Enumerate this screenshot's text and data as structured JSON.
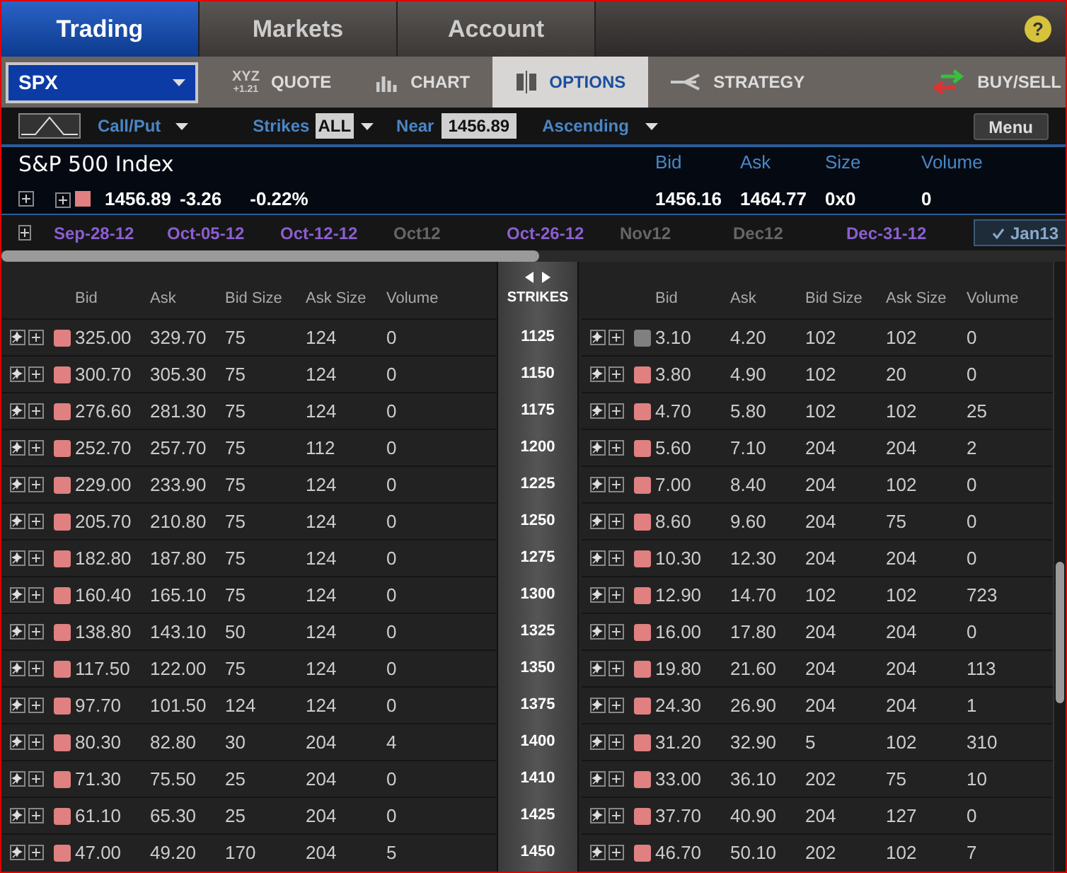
{
  "nav_tabs": [
    {
      "label": "Trading",
      "selected": true
    },
    {
      "label": "Markets",
      "selected": false
    },
    {
      "label": "Account",
      "selected": false
    }
  ],
  "help": {
    "label": "?"
  },
  "symbol": {
    "value": "SPX"
  },
  "sub_tabs": [
    {
      "label": "QUOTE",
      "kind": "quote",
      "selected": false,
      "icon_text": "XYZ",
      "icon_subtext": "+1.21"
    },
    {
      "label": "CHART",
      "kind": "chart",
      "selected": false
    },
    {
      "label": "OPTIONS",
      "kind": "options",
      "selected": true
    },
    {
      "label": "STRATEGY",
      "kind": "strategy",
      "selected": false
    }
  ],
  "buy_sell": {
    "label": "BUY/SELL"
  },
  "filters": {
    "call_put": "Call/Put",
    "strikes_label": "Strikes",
    "strikes_value": "ALL",
    "near_label": "Near",
    "near_value": "1456.89",
    "sort": "Ascending",
    "menu": "Menu"
  },
  "index": {
    "name": "S&P 500 Index",
    "last": "1456.89",
    "change": "-3.26",
    "percent": "-0.22%",
    "color": "#e08080",
    "columns": [
      "Bid",
      "Ask",
      "Size",
      "Volume"
    ],
    "values": [
      "1456.16",
      "1464.77",
      "0x0",
      "0"
    ]
  },
  "expiries": [
    {
      "label": "Sep-28-12",
      "selected": false,
      "disabled": false
    },
    {
      "label": "Oct-05-12",
      "selected": false,
      "disabled": false
    },
    {
      "label": "Oct-12-12",
      "selected": false,
      "disabled": false
    },
    {
      "label": "Oct12",
      "selected": false,
      "disabled": true
    },
    {
      "label": "Oct-26-12",
      "selected": false,
      "disabled": false
    },
    {
      "label": "Nov12",
      "selected": false,
      "disabled": true
    },
    {
      "label": "Dec12",
      "selected": false,
      "disabled": true
    },
    {
      "label": "Dec-31-12",
      "selected": false,
      "disabled": false
    },
    {
      "label": "Jan13",
      "selected": true,
      "disabled": false
    }
  ],
  "table": {
    "call_columns": [
      "Bid",
      "Ask",
      "Bid Size",
      "Ask Size",
      "Volume"
    ],
    "strikes_header": "STRIKES",
    "put_columns": [
      "Bid",
      "Ask",
      "Bid Size",
      "Ask Size",
      "Volume"
    ],
    "rows": [
      {
        "strike": "1125",
        "call": {
          "color": "#e08080",
          "values": [
            "325.00",
            "329.70",
            "75",
            "124",
            "0"
          ]
        },
        "put": {
          "color": "#808080",
          "values": [
            "3.10",
            "4.20",
            "102",
            "102",
            "0"
          ]
        }
      },
      {
        "strike": "1150",
        "call": {
          "color": "#e08080",
          "values": [
            "300.70",
            "305.30",
            "75",
            "124",
            "0"
          ]
        },
        "put": {
          "color": "#e08080",
          "values": [
            "3.80",
            "4.90",
            "102",
            "20",
            "0"
          ]
        }
      },
      {
        "strike": "1175",
        "call": {
          "color": "#e08080",
          "values": [
            "276.60",
            "281.30",
            "75",
            "124",
            "0"
          ]
        },
        "put": {
          "color": "#e08080",
          "values": [
            "4.70",
            "5.80",
            "102",
            "102",
            "25"
          ]
        }
      },
      {
        "strike": "1200",
        "call": {
          "color": "#e08080",
          "values": [
            "252.70",
            "257.70",
            "75",
            "112",
            "0"
          ]
        },
        "put": {
          "color": "#e08080",
          "values": [
            "5.60",
            "7.10",
            "204",
            "204",
            "2"
          ]
        }
      },
      {
        "strike": "1225",
        "call": {
          "color": "#e08080",
          "values": [
            "229.00",
            "233.90",
            "75",
            "124",
            "0"
          ]
        },
        "put": {
          "color": "#e08080",
          "values": [
            "7.00",
            "8.40",
            "204",
            "102",
            "0"
          ]
        }
      },
      {
        "strike": "1250",
        "call": {
          "color": "#e08080",
          "values": [
            "205.70",
            "210.80",
            "75",
            "124",
            "0"
          ]
        },
        "put": {
          "color": "#e08080",
          "values": [
            "8.60",
            "9.60",
            "204",
            "75",
            "0"
          ]
        }
      },
      {
        "strike": "1275",
        "call": {
          "color": "#e08080",
          "values": [
            "182.80",
            "187.80",
            "75",
            "124",
            "0"
          ]
        },
        "put": {
          "color": "#e08080",
          "values": [
            "10.30",
            "12.30",
            "204",
            "204",
            "0"
          ]
        }
      },
      {
        "strike": "1300",
        "call": {
          "color": "#e08080",
          "values": [
            "160.40",
            "165.10",
            "75",
            "124",
            "0"
          ]
        },
        "put": {
          "color": "#e08080",
          "values": [
            "12.90",
            "14.70",
            "102",
            "102",
            "723"
          ]
        }
      },
      {
        "strike": "1325",
        "call": {
          "color": "#e08080",
          "values": [
            "138.80",
            "143.10",
            "50",
            "124",
            "0"
          ]
        },
        "put": {
          "color": "#e08080",
          "values": [
            "16.00",
            "17.80",
            "204",
            "204",
            "0"
          ]
        }
      },
      {
        "strike": "1350",
        "call": {
          "color": "#e08080",
          "values": [
            "117.50",
            "122.00",
            "75",
            "124",
            "0"
          ]
        },
        "put": {
          "color": "#e08080",
          "values": [
            "19.80",
            "21.60",
            "204",
            "204",
            "113"
          ]
        }
      },
      {
        "strike": "1375",
        "call": {
          "color": "#e08080",
          "values": [
            "97.70",
            "101.50",
            "124",
            "124",
            "0"
          ]
        },
        "put": {
          "color": "#e08080",
          "values": [
            "24.30",
            "26.90",
            "204",
            "204",
            "1"
          ]
        }
      },
      {
        "strike": "1400",
        "call": {
          "color": "#e08080",
          "values": [
            "80.30",
            "82.80",
            "30",
            "204",
            "4"
          ]
        },
        "put": {
          "color": "#e08080",
          "values": [
            "31.20",
            "32.90",
            "5",
            "102",
            "310"
          ]
        }
      },
      {
        "strike": "1410",
        "call": {
          "color": "#e08080",
          "values": [
            "71.30",
            "75.50",
            "25",
            "204",
            "0"
          ]
        },
        "put": {
          "color": "#e08080",
          "values": [
            "33.00",
            "36.10",
            "202",
            "75",
            "10"
          ]
        }
      },
      {
        "strike": "1425",
        "call": {
          "color": "#e08080",
          "values": [
            "61.10",
            "65.30",
            "25",
            "204",
            "0"
          ]
        },
        "put": {
          "color": "#e08080",
          "values": [
            "37.70",
            "40.90",
            "204",
            "127",
            "0"
          ]
        }
      },
      {
        "strike": "1450",
        "call": {
          "color": "#e08080",
          "values": [
            "47.00",
            "49.20",
            "170",
            "204",
            "5"
          ]
        },
        "put": {
          "color": "#e08080",
          "values": [
            "46.70",
            "50.10",
            "202",
            "102",
            "7"
          ]
        }
      }
    ]
  }
}
